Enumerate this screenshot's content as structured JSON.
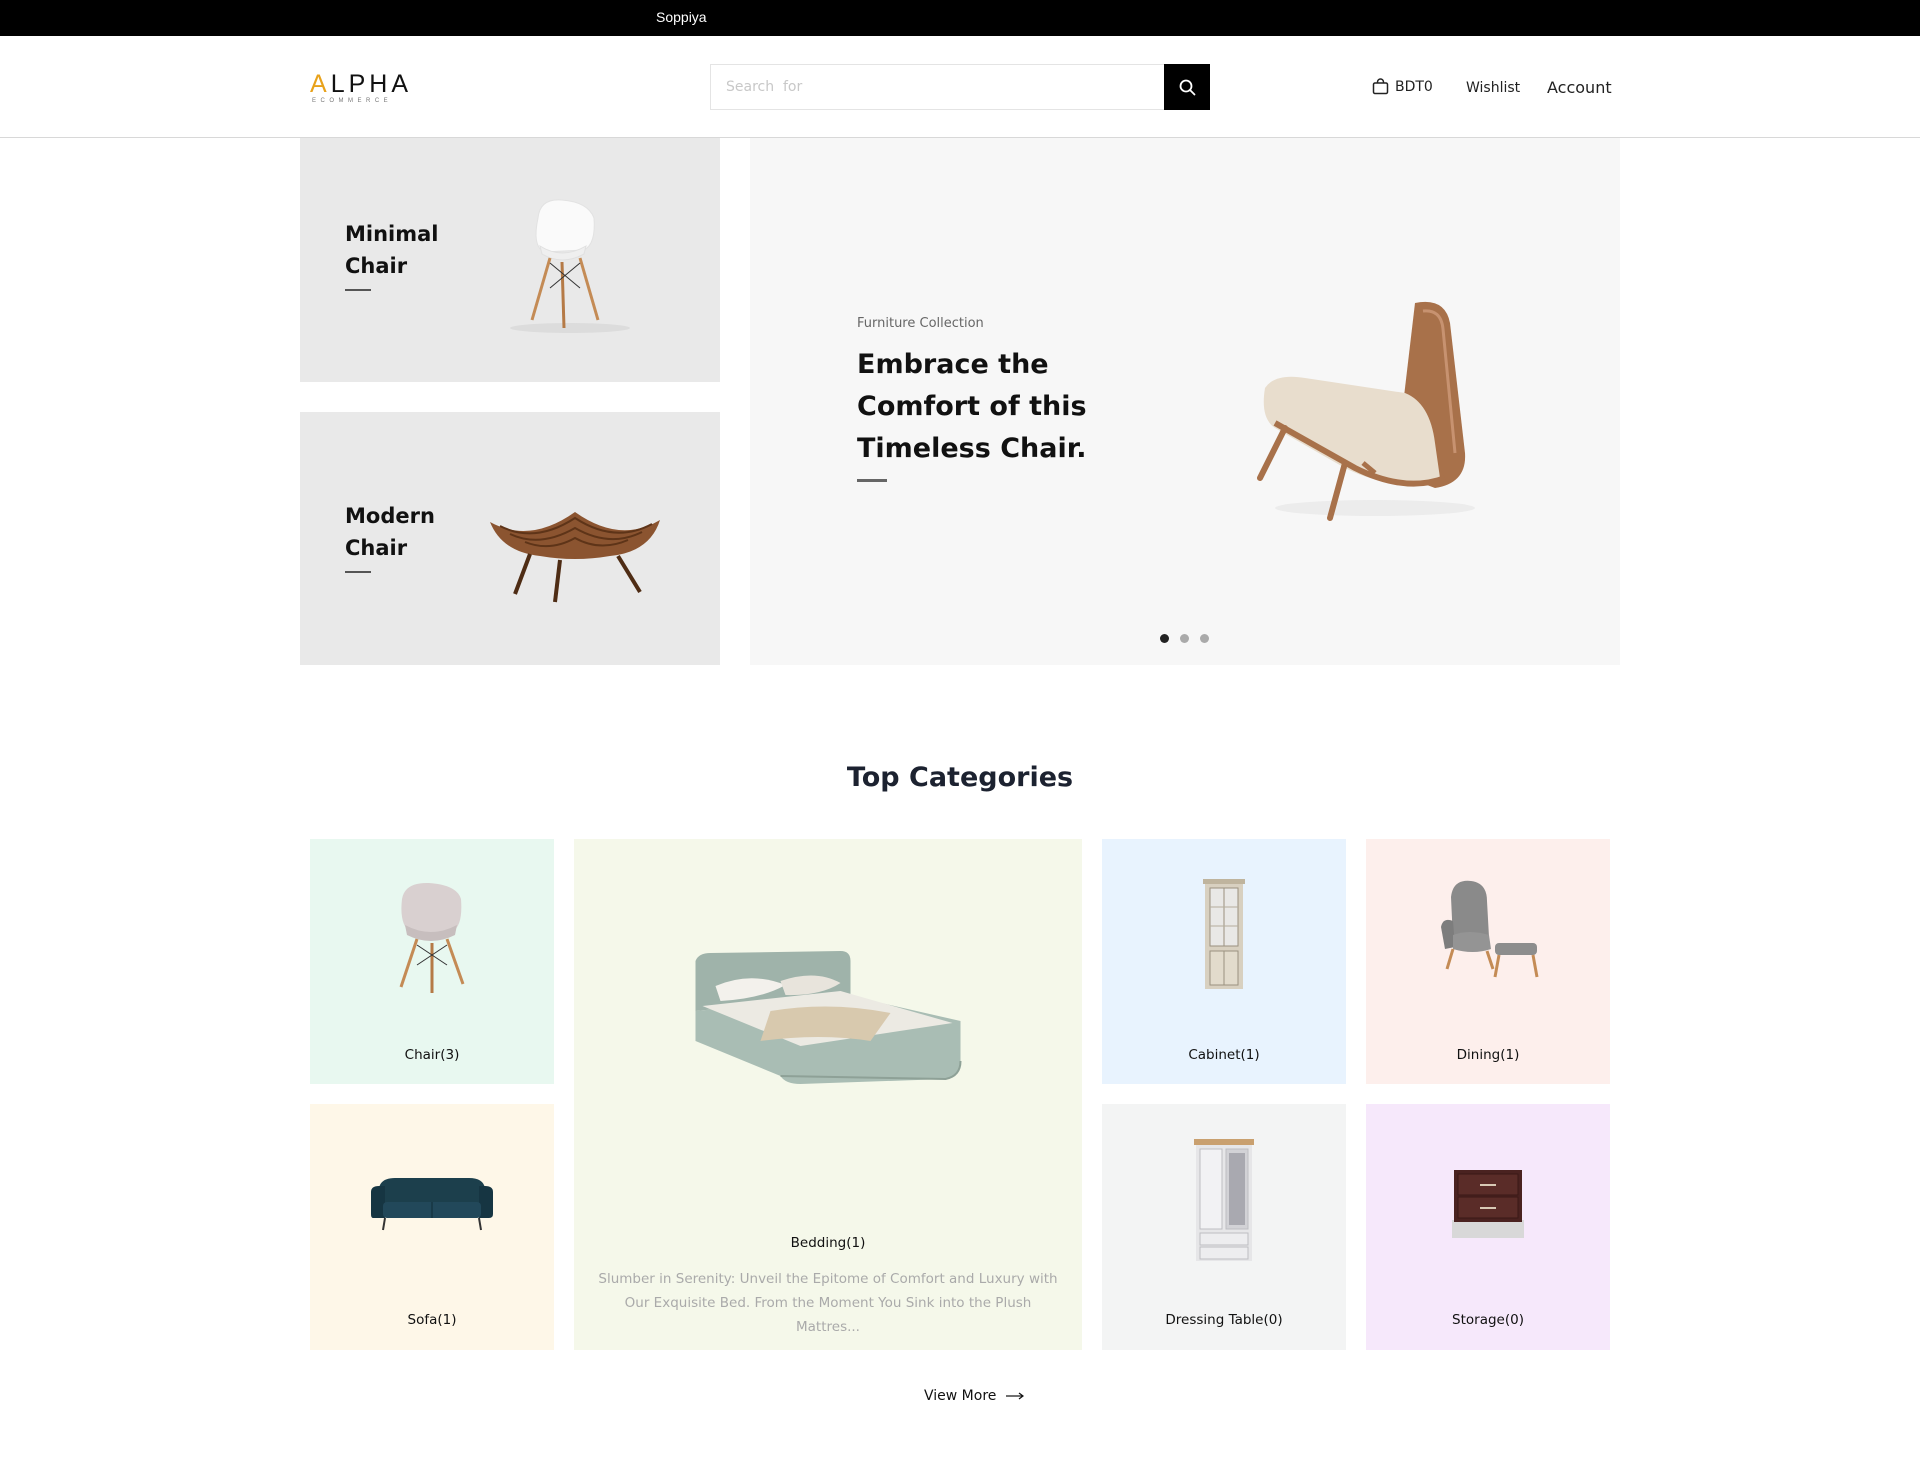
{
  "topbar": {
    "text": "Soppiya"
  },
  "header": {
    "logo_main_accent": "A",
    "logo_main_rest": "LPHA",
    "logo_sub": "ECOMMERCE",
    "search_placeholder": "Search  for",
    "cart_amount": "BDT0",
    "wishlist_label": "Wishlist",
    "account_label": "Account"
  },
  "hero": {
    "side_cards": [
      {
        "title_line1": "Minimal",
        "title_line2": "Chair"
      },
      {
        "title_line1": "Modern",
        "title_line2": "Chair"
      }
    ],
    "slide": {
      "subtitle": "Furniture Collection",
      "title": "Embrace the Comfort of this Timeless Chair."
    },
    "slide_count": 3,
    "active_slide": 1
  },
  "categories": {
    "title": "Top Categories",
    "items": [
      {
        "label": "Chair(3)",
        "bg": "#e8f8f0"
      },
      {
        "label": "Bedding(1)",
        "bg": "#f5f8ea",
        "description": "Slumber in Serenity: Unveil the Epitome of Comfort and Luxury with Our Exquisite Bed. From the Moment You Sink into the Plush Mattres..."
      },
      {
        "label": "Cabinet(1)",
        "bg": "#e8f3fe"
      },
      {
        "label": "Dining(1)",
        "bg": "#fdefec"
      },
      {
        "label": "Sofa(1)",
        "bg": "#fef7e8"
      },
      {
        "label": "Dressing Table(0)",
        "bg": "#f3f4f4"
      },
      {
        "label": "Storage(0)",
        "bg": "#f6e8fb"
      }
    ],
    "view_more_label": "View More"
  }
}
